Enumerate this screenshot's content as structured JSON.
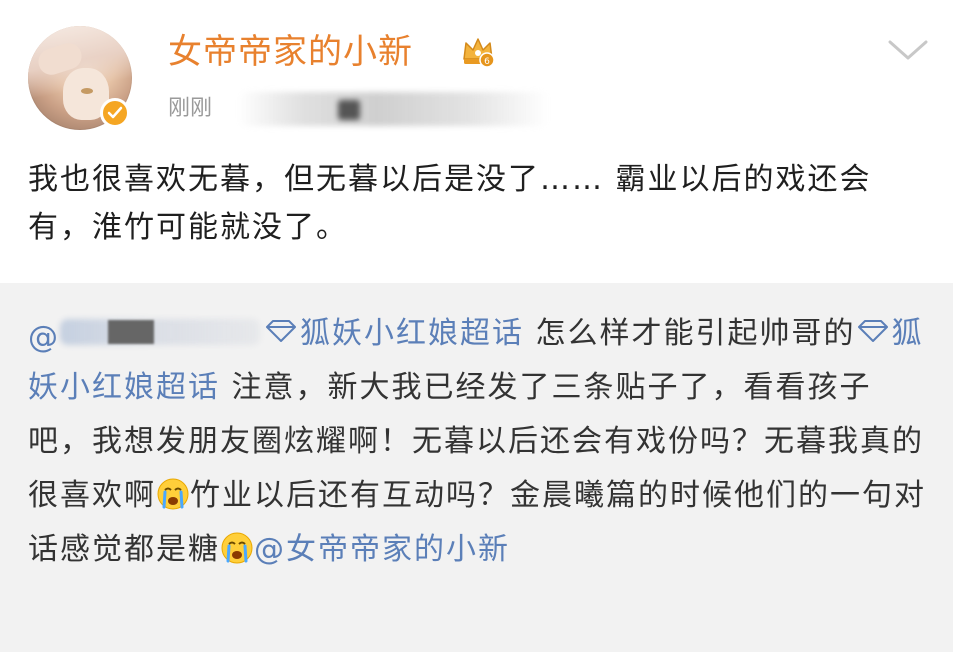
{
  "post": {
    "username": "女帝帝家的小新",
    "time": "刚刚",
    "text": "我也很喜欢无暮，但无暮以后是没了…… 霸业以后的戏还会有，淮竹可能就没了。",
    "crown_icon": "crown-icon",
    "verified_icon": "verified-icon",
    "menu_icon": "chevron-down-icon"
  },
  "repost": {
    "at_prefix": "@",
    "topic1": "狐妖小红娘超话",
    "text1": " 怎么样才能引起帅哥的",
    "topic2": "狐妖小红娘超话",
    "text2": " 注意，新大我已经发了三条贴子了，看看孩子吧，我想发朋友圈炫耀啊！无暮以后还会有戏份吗？无暮我真的很喜欢啊",
    "text3": "竹业以后还有互动吗？金晨曦篇的时候他们的一句对话感觉都是糖",
    "mention": "@女帝帝家的小新",
    "emoji_name": "crying-face-emoji"
  },
  "colors": {
    "username": "#e8812e",
    "link": "#5b7fb8",
    "repost_bg": "#f2f2f2",
    "badge": "#f5a623"
  }
}
